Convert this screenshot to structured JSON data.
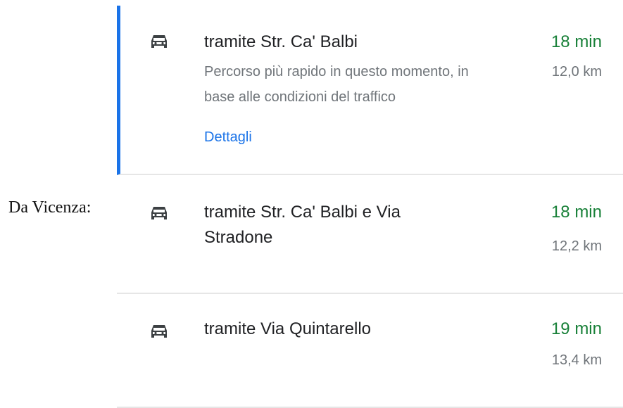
{
  "caption": "Da Vicenza:",
  "accent_color": "#1a73e8",
  "time_color": "#188038",
  "routes": [
    {
      "icon": "car-icon",
      "name": "tramite Str. Ca' Balbi",
      "description": "Percorso più rapido in questo momento, in base alle condizioni del traffico",
      "details_label": "Dettagli",
      "time": "18 min",
      "distance": "12,0 km",
      "selected": true
    },
    {
      "icon": "car-icon",
      "name": "tramite Str. Ca' Balbi e Via Stradone",
      "time": "18 min",
      "distance": "12,2 km",
      "selected": false
    },
    {
      "icon": "car-icon",
      "name": "tramite Via Quintarello",
      "time": "19 min",
      "distance": "13,4 km",
      "selected": false
    }
  ]
}
